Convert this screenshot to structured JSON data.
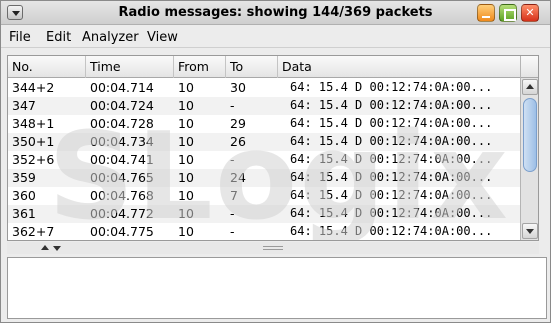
{
  "window": {
    "title": "Radio messages: showing 144/369 packets"
  },
  "menubar": {
    "items": [
      "File",
      "Edit",
      "Analyzer",
      "View"
    ]
  },
  "watermark": {
    "text": "SLogix"
  },
  "table": {
    "columns": [
      "No.",
      "Time",
      "From",
      "To",
      "Data"
    ],
    "rows": [
      {
        "no": "344+2",
        "time": "00:04.714",
        "from": "10",
        "to": "30",
        "data": "64: 15.4 D 00:12:74:0A:00..."
      },
      {
        "no": "347",
        "time": "00:04.724",
        "from": "10",
        "to": "-",
        "data": "64: 15.4 D 00:12:74:0A:00..."
      },
      {
        "no": "348+1",
        "time": "00:04.728",
        "from": "10",
        "to": "29",
        "data": "64: 15.4 D 00:12:74:0A:00..."
      },
      {
        "no": "350+1",
        "time": "00:04.734",
        "from": "10",
        "to": "26",
        "data": "64: 15.4 D 00:12:74:0A:00..."
      },
      {
        "no": "352+6",
        "time": "00:04.741",
        "from": "10",
        "to": "-",
        "data": "64: 15.4 D 00:12:74:0A:00..."
      },
      {
        "no": "359",
        "time": "00:04.765",
        "from": "10",
        "to": "24",
        "data": "64: 15.4 D 00:12:74:0A:00..."
      },
      {
        "no": "360",
        "time": "00:04.768",
        "from": "10",
        "to": "7",
        "data": "64: 15.4 D 00:12:74:0A:00..."
      },
      {
        "no": "361",
        "time": "00:04.772",
        "from": "10",
        "to": "-",
        "data": "64: 15.4 D 00:12:74:0A:00..."
      },
      {
        "no": "362+7",
        "time": "00:04.775",
        "from": "10",
        "to": "-",
        "data": "64: 15.4 D 00:12:74:0A:00..."
      }
    ]
  },
  "colors": {
    "row_alt": "#f2f2f2",
    "scroll_thumb": "#9dbfe6",
    "btn_minimize": "#f08a1c",
    "btn_maximize": "#5da323",
    "btn_close": "#d6301a"
  }
}
